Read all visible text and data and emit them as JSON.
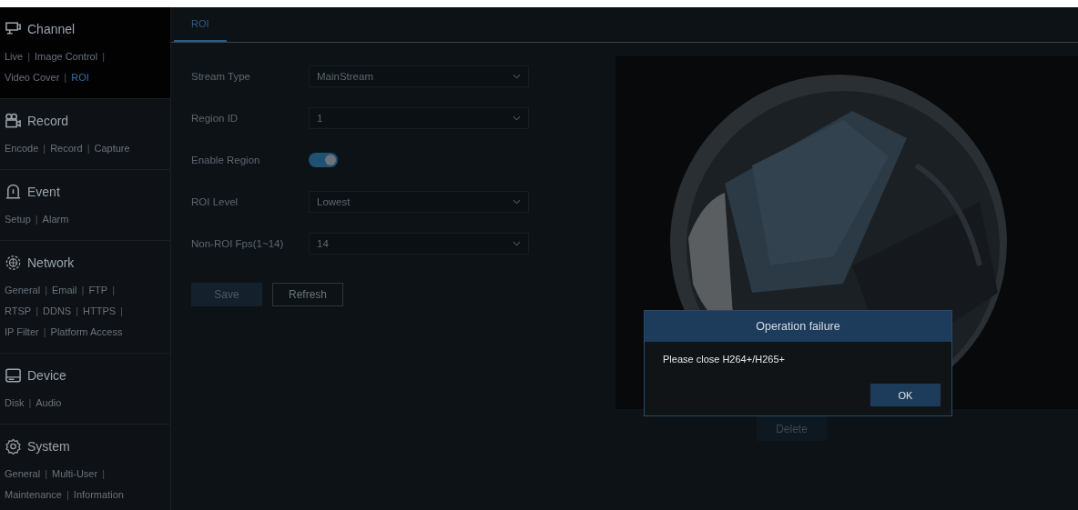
{
  "sidebar": {
    "separator": "|",
    "sections": [
      {
        "title": "Channel",
        "active": true,
        "lines": [
          [
            {
              "label": "Live",
              "selected": false
            },
            {
              "label": "Image Control",
              "selected": false
            }
          ],
          [
            {
              "label": "Video Cover",
              "selected": false
            },
            {
              "label": "ROI",
              "selected": true
            }
          ]
        ]
      },
      {
        "title": "Record",
        "active": false,
        "lines": [
          [
            {
              "label": "Encode",
              "selected": false
            },
            {
              "label": "Record",
              "selected": false
            },
            {
              "label": "Capture",
              "selected": false
            }
          ]
        ]
      },
      {
        "title": "Event",
        "active": false,
        "lines": [
          [
            {
              "label": "Setup",
              "selected": false
            },
            {
              "label": "Alarm",
              "selected": false
            }
          ]
        ]
      },
      {
        "title": "Network",
        "active": false,
        "lines": [
          [
            {
              "label": "General",
              "selected": false
            },
            {
              "label": "Email",
              "selected": false
            },
            {
              "label": "FTP",
              "selected": false
            }
          ],
          [
            {
              "label": "RTSP",
              "selected": false
            },
            {
              "label": "DDNS",
              "selected": false
            },
            {
              "label": "HTTPS",
              "selected": false
            }
          ],
          [
            {
              "label": "IP Filter",
              "selected": false
            },
            {
              "label": "Platform Access",
              "selected": false
            }
          ]
        ]
      },
      {
        "title": "Device",
        "active": false,
        "lines": [
          [
            {
              "label": "Disk",
              "selected": false
            },
            {
              "label": "Audio",
              "selected": false
            }
          ]
        ]
      },
      {
        "title": "System",
        "active": false,
        "lines": [
          [
            {
              "label": "General",
              "selected": false
            },
            {
              "label": "Multi-User",
              "selected": false
            }
          ],
          [
            {
              "label": "Maintenance",
              "selected": false
            },
            {
              "label": "Information",
              "selected": false
            }
          ]
        ]
      }
    ]
  },
  "tabs": [
    {
      "label": "ROI",
      "selected": true
    }
  ],
  "form": [
    {
      "kind": "select",
      "label": "Stream Type",
      "value": "MainStream"
    },
    {
      "kind": "select",
      "label": "Region ID",
      "value": "1"
    },
    {
      "kind": "toggle",
      "label": "Enable Region",
      "on": true
    },
    {
      "kind": "select",
      "label": "ROI Level",
      "value": "Lowest"
    },
    {
      "kind": "select",
      "label": "Non-ROI Fps(1~14)",
      "value": "14"
    }
  ],
  "buttons": [
    {
      "label": "Save",
      "kind": "primary"
    },
    {
      "label": "Refresh",
      "kind": "outline"
    }
  ],
  "preview": {
    "kind": "picture",
    "delete_button": "Delete"
  },
  "dialog": {
    "title": "Operation failure",
    "message": "Please close H264+/H265+",
    "ok": "OK"
  }
}
